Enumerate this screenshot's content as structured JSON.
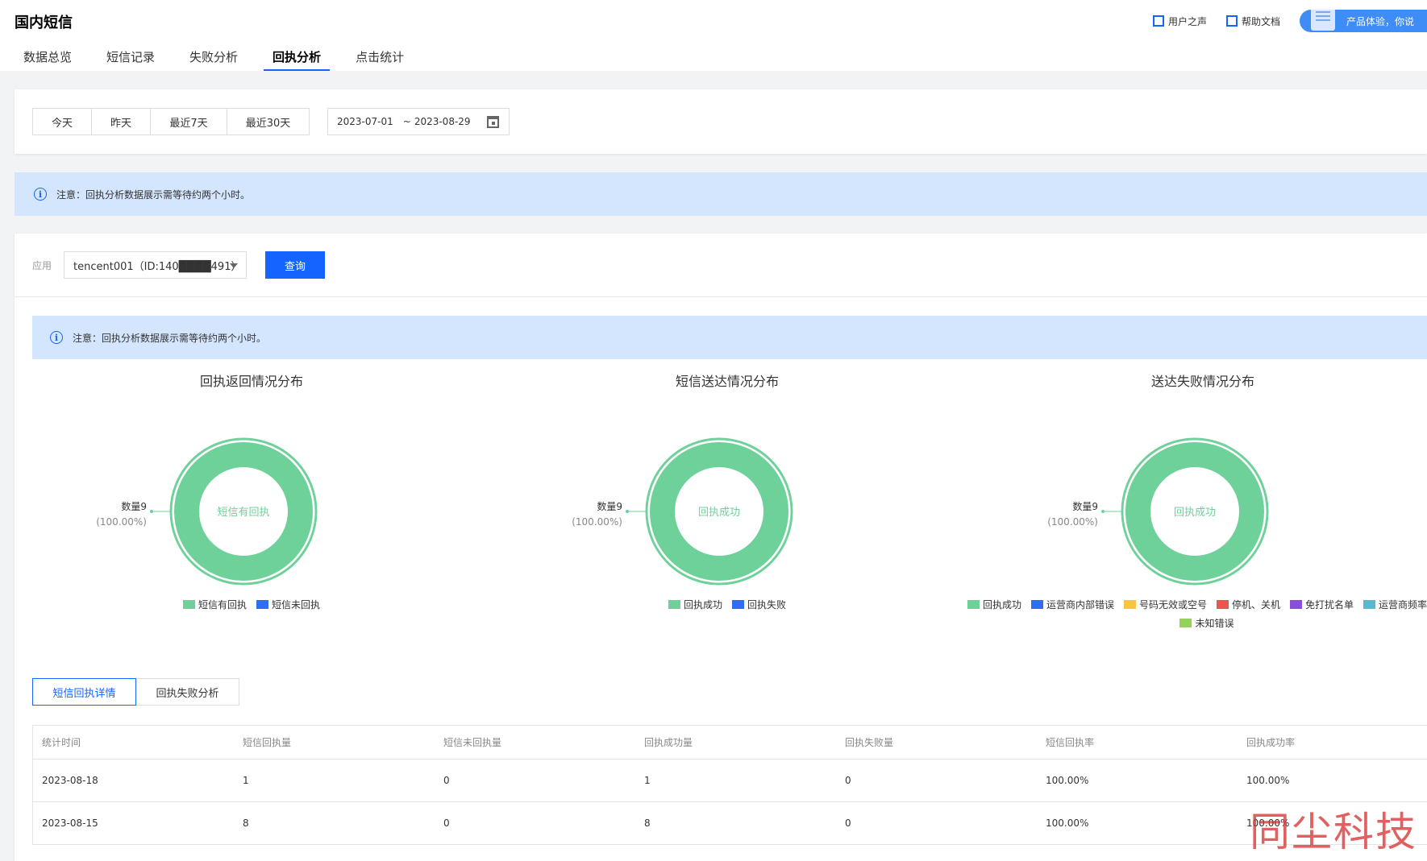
{
  "header": {
    "title": "国内短信",
    "links": {
      "user_voice": "用户之声",
      "help_docs": "帮助文档",
      "feedback": "产品体验，你说"
    }
  },
  "tabs": [
    "数据总览",
    "短信记录",
    "失败分析",
    "回执分析",
    "点击统计"
  ],
  "active_tab": "回执分析",
  "date_filter": {
    "buttons": [
      "今天",
      "昨天",
      "最近7天",
      "最近30天"
    ],
    "range_start": "2023-07-01",
    "range_sep": "~",
    "range_end": "2023-08-29"
  },
  "notice": "注意：回执分析数据展示需等待约两个小时。",
  "filter": {
    "label": "应用",
    "app_value": "tencent001（ID:140████491）",
    "query_label": "查询"
  },
  "charts": [
    {
      "title": "回执返回情况分布",
      "center": "短信有回执",
      "count_label": "数量9",
      "pct_label": "(100.00%)",
      "legend": [
        {
          "name": "短信有回执",
          "color": "#6ed19a"
        },
        {
          "name": "短信未回执",
          "color": "#2e6ff2"
        }
      ]
    },
    {
      "title": "短信送达情况分布",
      "center": "回执成功",
      "count_label": "数量9",
      "pct_label": "(100.00%)",
      "legend": [
        {
          "name": "回执成功",
          "color": "#6ed19a"
        },
        {
          "name": "回执失败",
          "color": "#2e6ff2"
        }
      ]
    },
    {
      "title": "送达失败情况分布",
      "center": "回执成功",
      "count_label": "数量9",
      "pct_label": "(100.00%)",
      "legend": [
        {
          "name": "回执成功",
          "color": "#6ed19a"
        },
        {
          "name": "运营商内部错误",
          "color": "#2e6ff2"
        },
        {
          "name": "号码无效或空号",
          "color": "#f6c544"
        },
        {
          "name": "停机、关机",
          "color": "#e8584f"
        },
        {
          "name": "免打扰名单",
          "color": "#8a4fd8"
        },
        {
          "name": "运营商频率限制",
          "color": "#5ab8d0"
        },
        {
          "name": "未知错误",
          "color": "#94d35a"
        }
      ]
    }
  ],
  "chart_data": [
    {
      "type": "pie",
      "title": "回执返回情况分布",
      "categories": [
        "短信有回执",
        "短信未回执"
      ],
      "values": [
        9,
        0
      ],
      "percent": [
        100.0,
        0.0
      ]
    },
    {
      "type": "pie",
      "title": "短信送达情况分布",
      "categories": [
        "回执成功",
        "回执失败"
      ],
      "values": [
        9,
        0
      ],
      "percent": [
        100.0,
        0.0
      ]
    },
    {
      "type": "pie",
      "title": "送达失败情况分布",
      "categories": [
        "回执成功",
        "运营商内部错误",
        "号码无效或空号",
        "停机、关机",
        "免打扰名单",
        "运营商频率限制",
        "未知错误"
      ],
      "values": [
        9,
        0,
        0,
        0,
        0,
        0,
        0
      ],
      "percent": [
        100.0,
        0,
        0,
        0,
        0,
        0,
        0
      ]
    }
  ],
  "detail_tabs": [
    "短信回执详情",
    "回执失败分析"
  ],
  "table": {
    "headers": [
      "统计时间",
      "短信回执量",
      "短信未回执量",
      "回执成功量",
      "回执失败量",
      "短信回执率",
      "回执成功率"
    ],
    "rows": [
      [
        "2023-08-18",
        "1",
        "0",
        "1",
        "0",
        "100.00%",
        "100.00%"
      ],
      [
        "2023-08-15",
        "8",
        "0",
        "8",
        "0",
        "100.00%",
        "100.00%"
      ]
    ]
  },
  "watermark": "同尘科技",
  "colors": {
    "accent": "#1664ff",
    "notice_bg": "#d4e5fe",
    "success": "#6ed19a"
  }
}
